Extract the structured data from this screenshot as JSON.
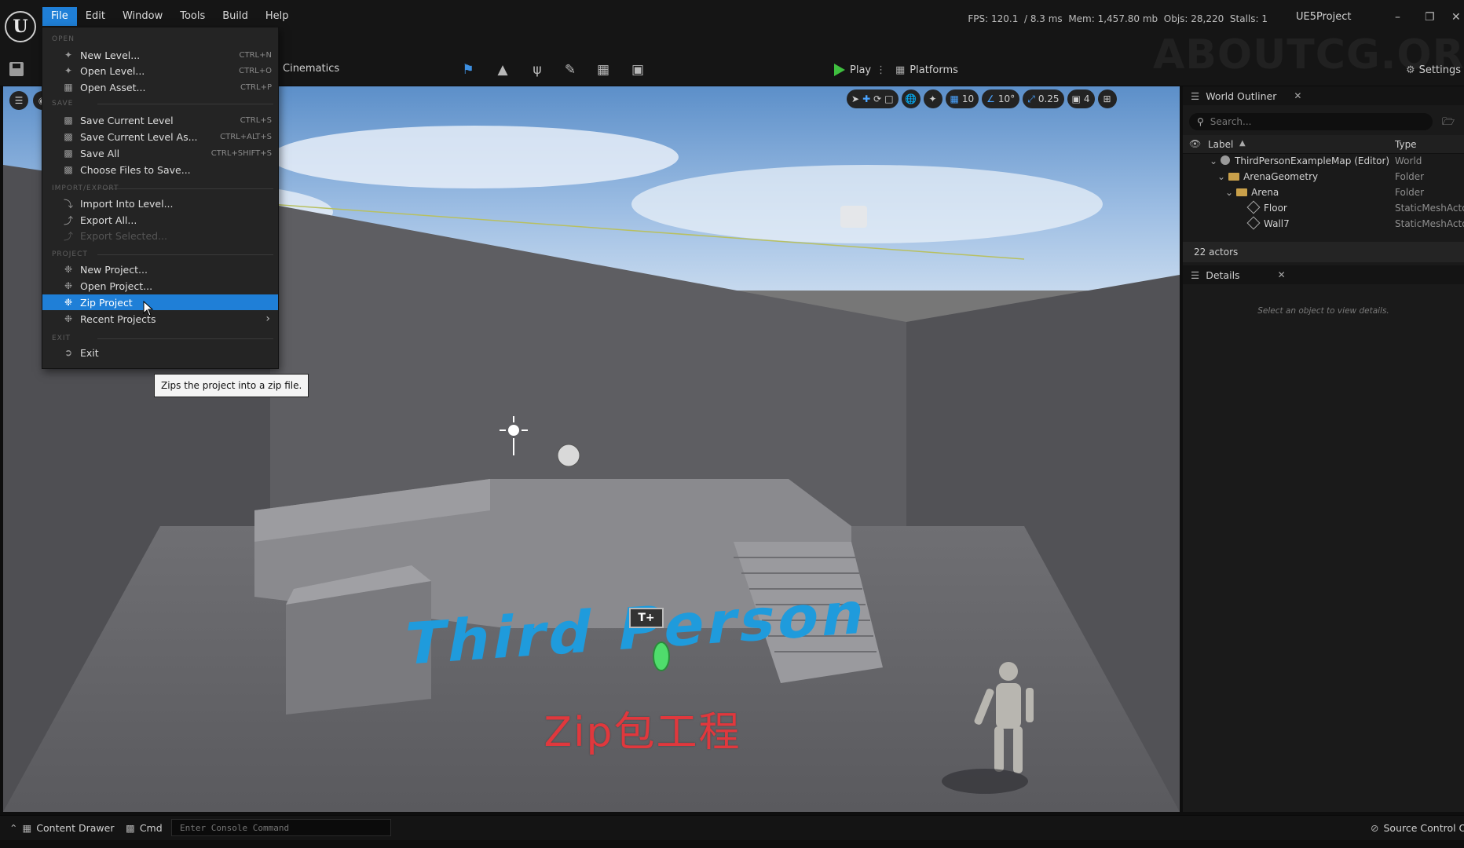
{
  "menubar": [
    "File",
    "Edit",
    "Window",
    "Tools",
    "Build",
    "Help"
  ],
  "stats": "FPS: 120.1  / 8.3 ms  Mem: 1,457.80 mb  Objs: 28,220  Stalls: 1",
  "project_name": "UE5Project",
  "watermark": "ABOUTCG.ORG",
  "toolbar": {
    "cinematics_label": "Cinematics",
    "play_label": "Play",
    "platforms_label": "Platforms",
    "settings_label": "Settings"
  },
  "file_menu": {
    "sections": [
      "OPEN",
      "SAVE",
      "IMPORT/EXPORT",
      "PROJECT",
      "EXIT"
    ],
    "items": [
      {
        "label": "New Level...",
        "shortcut": "CTRL+N"
      },
      {
        "label": "Open Level...",
        "shortcut": "CTRL+O"
      },
      {
        "label": "Open Asset...",
        "shortcut": "CTRL+P"
      },
      {
        "label": "Save Current Level",
        "shortcut": "CTRL+S"
      },
      {
        "label": "Save Current Level As...",
        "shortcut": "CTRL+ALT+S"
      },
      {
        "label": "Save All",
        "shortcut": "CTRL+SHIFT+S"
      },
      {
        "label": "Choose Files to Save...",
        "shortcut": ""
      },
      {
        "label": "Import Into Level...",
        "shortcut": ""
      },
      {
        "label": "Export All...",
        "shortcut": ""
      },
      {
        "label": "Export Selected...",
        "shortcut": ""
      },
      {
        "label": "New Project...",
        "shortcut": ""
      },
      {
        "label": "Open Project...",
        "shortcut": ""
      },
      {
        "label": "Zip Project",
        "shortcut": ""
      },
      {
        "label": "Recent Projects",
        "shortcut": ""
      },
      {
        "label": "Exit",
        "shortcut": ""
      }
    ],
    "tooltip": "Zips the project into a zip file."
  },
  "viewport": {
    "toolbar_values": {
      "grid": "10",
      "rotation": "10°",
      "scale": "0.25",
      "camera": "4"
    },
    "scene_text": "Third Person",
    "text_actor": "T+",
    "subtitle": "Zip包工程"
  },
  "outliner": {
    "tab_label": "World Outliner",
    "search_placeholder": "Search...",
    "col_label": "Label",
    "col_type": "Type",
    "rows": [
      {
        "name": "ThirdPersonExampleMap (Editor)",
        "type": "World"
      },
      {
        "name": "ArenaGeometry",
        "type": "Folder"
      },
      {
        "name": "Arena",
        "type": "Folder"
      },
      {
        "name": "Floor",
        "type": "StaticMeshActo"
      },
      {
        "name": "Wall7",
        "type": "StaticMeshActo"
      }
    ],
    "actor_count": "22 actors"
  },
  "details": {
    "tab_label": "Details",
    "empty_message": "Select an object to view details."
  },
  "statusbar": {
    "content_drawer": "Content Drawer",
    "cmd": "Cmd",
    "console_placeholder": "Enter Console Command",
    "source_control": "Source Control Of"
  },
  "colors": {
    "accent": "#1f7fd7",
    "scene_text": "#1f9bdc",
    "subtitle": "#e0383d",
    "play": "#3fbf3f"
  }
}
